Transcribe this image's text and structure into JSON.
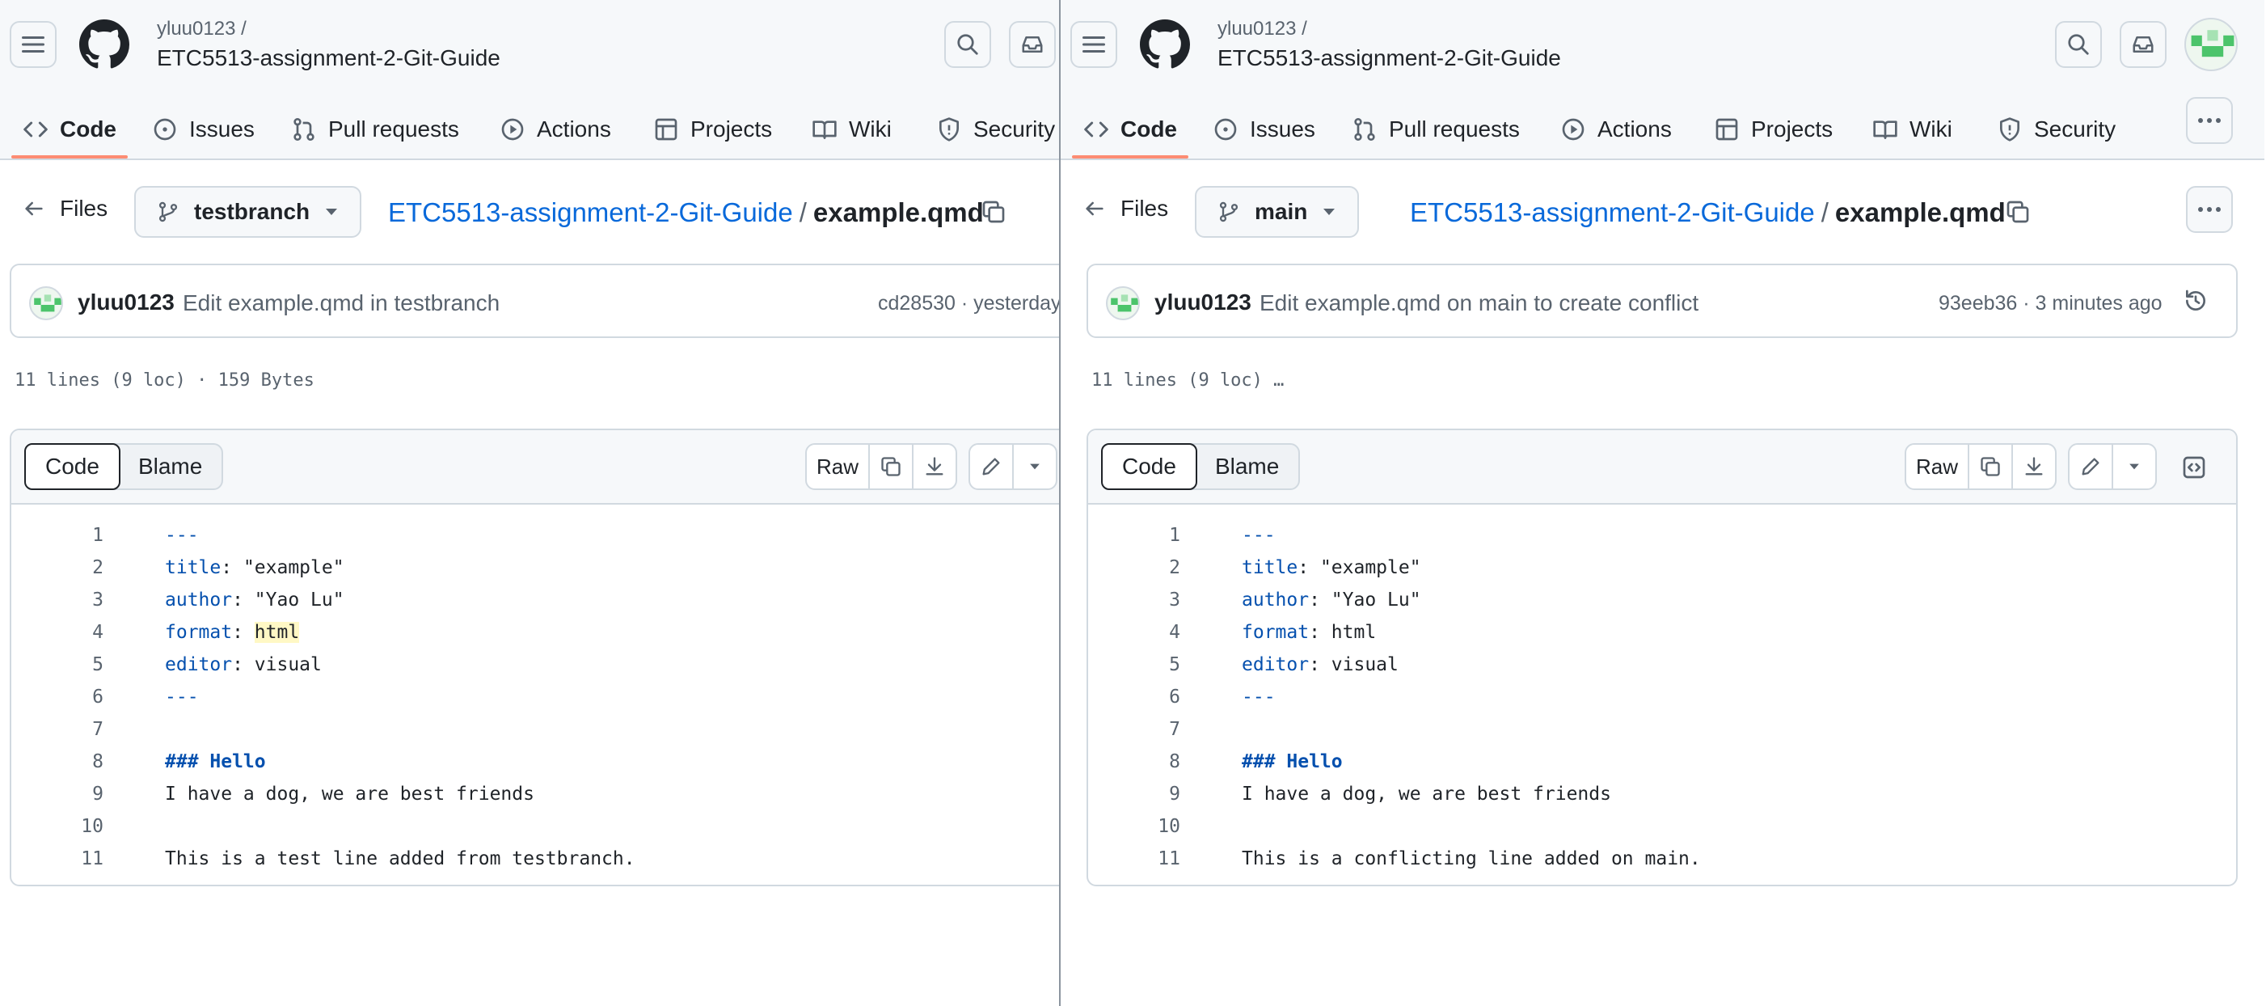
{
  "left": {
    "owner": "yluu0123 /",
    "repo": "ETC5513-assignment-2-Git-Guide",
    "nav": [
      "Code",
      "Issues",
      "Pull requests",
      "Actions",
      "Projects",
      "Wiki",
      "Security"
    ],
    "back_label": "Files",
    "branch": "testbranch",
    "crumb_repo": "ETC5513-assignment-2-Git-Guide",
    "crumb_sep": "/",
    "crumb_file": "example.qmd",
    "commit_user": "yluu0123",
    "commit_msg": "Edit example.qmd in testbranch",
    "commit_meta": "cd28530 · yesterday",
    "file_info": "11 lines (9 loc) · 159 Bytes",
    "tab_code": "Code",
    "tab_blame": "Blame",
    "raw": "Raw",
    "lines": [
      {
        "n": "1",
        "k": "",
        "v": "---"
      },
      {
        "n": "2",
        "k": "title",
        "v": ": \"example\""
      },
      {
        "n": "3",
        "k": "author",
        "v": ": \"Yao Lu\""
      },
      {
        "n": "4",
        "k": "format",
        "v": ": ",
        "hl": "html"
      },
      {
        "n": "5",
        "k": "editor",
        "v": ": visual"
      },
      {
        "n": "6",
        "k": "",
        "v": "---"
      },
      {
        "n": "7",
        "k": "",
        "v": ""
      },
      {
        "n": "8",
        "k": "",
        "h": "### Hello",
        "v": ""
      },
      {
        "n": "9",
        "k": "",
        "v": "I have a dog, we are best friends"
      },
      {
        "n": "10",
        "k": "",
        "v": ""
      },
      {
        "n": "11",
        "k": "",
        "v": "This is a test line added from testbranch."
      }
    ]
  },
  "right": {
    "owner": "yluu0123 /",
    "repo": "ETC5513-assignment-2-Git-Guide",
    "nav": [
      "Code",
      "Issues",
      "Pull requests",
      "Actions",
      "Projects",
      "Wiki",
      "Security"
    ],
    "back_label": "Files",
    "branch": "main",
    "crumb_repo": "ETC5513-assignment-2-Git-Guide",
    "crumb_sep": "/",
    "crumb_file": "example.qmd",
    "commit_user": "yluu0123",
    "commit_msg": "Edit example.qmd on main to create conflict",
    "commit_meta": "93eeb36 · 3 minutes ago",
    "file_info": "11 lines (9 loc) …",
    "tab_code": "Code",
    "tab_blame": "Blame",
    "raw": "Raw",
    "lines": [
      {
        "n": "1",
        "k": "",
        "v": "---"
      },
      {
        "n": "2",
        "k": "title",
        "v": ": \"example\""
      },
      {
        "n": "3",
        "k": "author",
        "v": ": \"Yao Lu\""
      },
      {
        "n": "4",
        "k": "format",
        "v": ": html"
      },
      {
        "n": "5",
        "k": "editor",
        "v": ": visual"
      },
      {
        "n": "6",
        "k": "",
        "v": "---"
      },
      {
        "n": "7",
        "k": "",
        "v": ""
      },
      {
        "n": "8",
        "k": "",
        "h": "### Hello",
        "v": ""
      },
      {
        "n": "9",
        "k": "",
        "v": "I have a dog, we are best friends"
      },
      {
        "n": "10",
        "k": "",
        "v": ""
      },
      {
        "n": "11",
        "k": "",
        "v": "This is a conflicting line added on main."
      }
    ]
  },
  "colors": {
    "link": "#0969da",
    "accent_underline": "#fd8c73",
    "key": "#0550ae",
    "highlight": "#fff8c5"
  }
}
